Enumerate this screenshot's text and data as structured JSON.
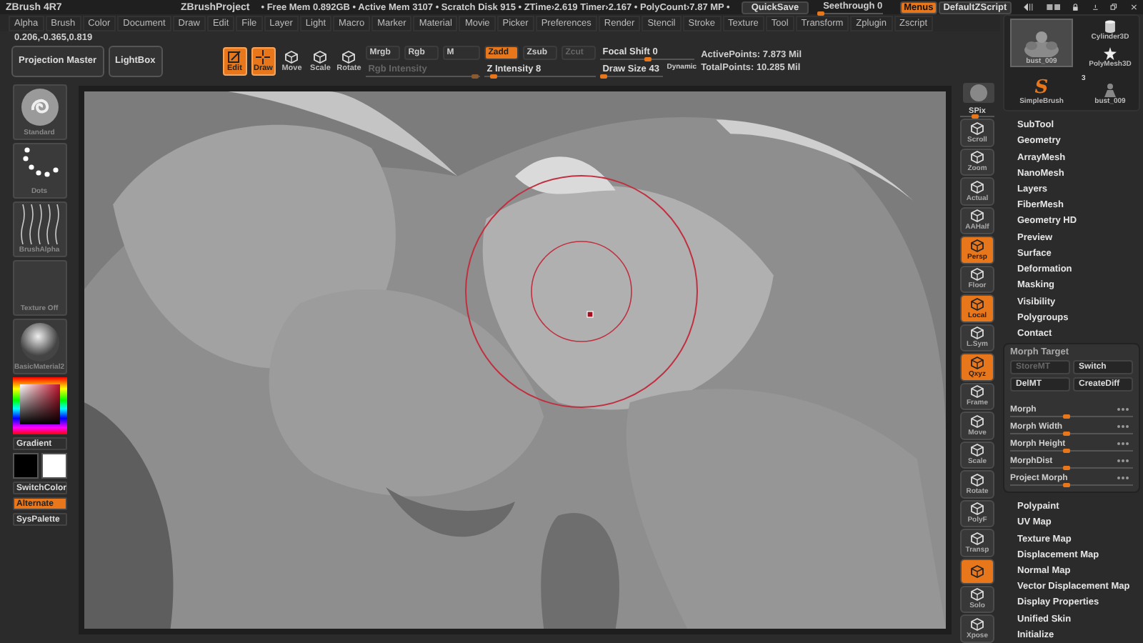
{
  "title_bar": {
    "app": "ZBrush 4R7",
    "project": "ZBrushProject",
    "status": "• Free Mem 0.892GB • Active Mem 3107 • Scratch Disk 915 • ZTime›2.619 Timer›2.167 • PolyCount›7.87 MP •",
    "quicksave": "QuickSave",
    "seethrough": {
      "label": "Seethrough 0",
      "level": 0
    },
    "menus": {
      "label": "Menus",
      "on": true
    },
    "script": "DefaultZScript"
  },
  "menu_bar": [
    "Alpha",
    "Brush",
    "Color",
    "Document",
    "Draw",
    "Edit",
    "File",
    "Layer",
    "Light",
    "Macro",
    "Marker",
    "Material",
    "Movie",
    "Picker",
    "Preferences",
    "Render",
    "Stencil",
    "Stroke",
    "Texture",
    "Tool",
    "Transform",
    "Zplugin",
    "Zscript"
  ],
  "coordinates": "0.206,-0.365,0.819",
  "toolbar": {
    "buttons": [
      "Projection Master",
      "LightBox"
    ],
    "modes": [
      {
        "label": "Edit",
        "kind": "edit",
        "on": true
      },
      {
        "label": "Draw",
        "kind": "draw",
        "on": true
      },
      {
        "label": "Move",
        "kind": "move",
        "on": false
      },
      {
        "label": "Scale",
        "kind": "scale",
        "on": false
      },
      {
        "label": "Rotate",
        "kind": "rotate",
        "on": false
      }
    ],
    "channels": [
      {
        "label": "Mrgb",
        "on": false
      },
      {
        "label": "Rgb",
        "on": false
      },
      {
        "label": "M",
        "on": false
      }
    ],
    "z_modes": [
      {
        "label": "Zadd",
        "on": true,
        "disabled": false
      },
      {
        "label": "Zsub",
        "on": false,
        "disabled": false
      },
      {
        "label": "Zcut",
        "on": false,
        "disabled": true
      }
    ],
    "sliders": [
      {
        "label": "Rgb Intensity",
        "level": 0.95,
        "disabled": true
      },
      {
        "label": "Z Intensity 8",
        "level": 0.08,
        "disabled": false
      },
      {
        "label": "Focal Shift 0",
        "level": 0.5,
        "disabled": false
      },
      {
        "label": "Draw Size 43",
        "level": 0.05,
        "disabled": false
      }
    ],
    "dynamic": "Dynamic",
    "stats": [
      "ActivePoints: 7.873 Mil",
      "TotalPoints: 10.285 Mil"
    ]
  },
  "left_shelf": {
    "thumbs": [
      {
        "label": "Standard",
        "kind": "brush"
      },
      {
        "label": "Dots",
        "kind": "stroke"
      },
      {
        "label": "BrushAlpha",
        "kind": "alpha"
      },
      {
        "label": "Texture Off",
        "kind": "texture"
      },
      {
        "label": "BasicMaterial2",
        "kind": "material"
      }
    ],
    "gradient": "Gradient",
    "swatches": [
      {
        "color": "#000000"
      },
      {
        "color": "#ffffff"
      }
    ],
    "buttons": [
      {
        "label": "SwitchColor",
        "on": false
      },
      {
        "label": "Alternate",
        "on": true
      },
      {
        "label": "SysPalette",
        "on": false
      }
    ]
  },
  "right_shelf": [
    {
      "label": "SPix",
      "kind": "slider",
      "level": 0.4
    },
    {
      "label": "Scroll",
      "kind": "button",
      "on": false
    },
    {
      "label": "Zoom",
      "kind": "button",
      "on": false
    },
    {
      "label": "Actual",
      "kind": "button",
      "on": false
    },
    {
      "label": "AAHalf",
      "kind": "button",
      "on": false
    },
    {
      "label": "Persp",
      "kind": "button",
      "on": true
    },
    {
      "label": "Floor",
      "kind": "button",
      "on": false
    },
    {
      "label": "Local",
      "kind": "button",
      "on": true
    },
    {
      "label": "L.Sym",
      "kind": "button",
      "on": false
    },
    {
      "label": "Qxyz",
      "kind": "button",
      "on": true
    },
    {
      "label": "Frame",
      "kind": "button",
      "on": false
    },
    {
      "label": "Move",
      "kind": "button",
      "on": false
    },
    {
      "label": "Scale",
      "kind": "button",
      "on": false
    },
    {
      "label": "Rotate",
      "kind": "button",
      "on": false
    },
    {
      "label": "PolyF",
      "kind": "button",
      "on": false
    },
    {
      "label": "Transp",
      "kind": "button",
      "on": false
    },
    {
      "kind": "button",
      "on": true
    },
    {
      "label": "Solo",
      "kind": "button",
      "on": false
    },
    {
      "label": "Xpose",
      "kind": "button",
      "on": false
    }
  ],
  "tool_palette": {
    "thumbnails": [
      {
        "label": "bust_009",
        "kind": "picture",
        "selected": true
      },
      {
        "label": "Cylinder3D",
        "kind": "cylinder",
        "selected": false
      },
      {
        "label": "PolyMesh3D",
        "kind": "star",
        "selected": false
      },
      {
        "label": "SimpleBrush",
        "kind": "logo",
        "glyph": "S",
        "selected": false
      },
      {
        "label": "bust_009",
        "kind": "small",
        "badge": "3",
        "selected": false
      }
    ],
    "sections": [
      "SubTool",
      "Geometry",
      "ArrayMesh",
      "NanoMesh",
      "Layers",
      "FiberMesh",
      "Geometry HD",
      "Preview",
      "Surface",
      "Deformation",
      "Masking",
      "Visibility",
      "Polygroups",
      "Contact"
    ],
    "morph_target": {
      "title": "Morph Target",
      "buttons": [
        {
          "label": "StoreMT",
          "disabled": true
        },
        {
          "label": "Switch",
          "disabled": false
        },
        {
          "label": "DelMT",
          "disabled": false
        },
        {
          "label": "CreateDiff",
          "disabled": false
        }
      ],
      "sliders": [
        {
          "label": "Morph",
          "level": 0.45
        },
        {
          "label": "Morph Width",
          "level": 0.45
        },
        {
          "label": "Morph Height",
          "level": 0.45
        },
        {
          "label": "MorphDist",
          "level": 0.45
        },
        {
          "label": "Project Morph",
          "level": 0.45
        }
      ]
    },
    "sections_after": [
      "Polypaint",
      "UV Map",
      "Texture Map",
      "Displacement Map",
      "Normal Map",
      "Vector Displacement Map",
      "Display Properties",
      "Unified Skin",
      "Initialize"
    ]
  }
}
